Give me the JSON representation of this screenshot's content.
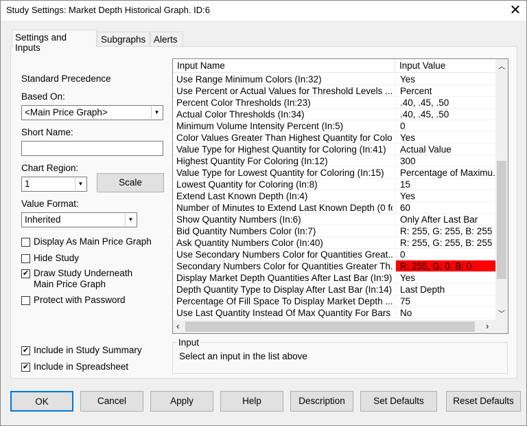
{
  "window": {
    "title": "Study Settings: Market Depth Historical Graph. ID:6",
    "close": "✕"
  },
  "tabs": [
    {
      "label": "Settings and Inputs"
    },
    {
      "label": "Subgraphs"
    },
    {
      "label": "Alerts"
    }
  ],
  "left": {
    "precedence": "Standard Precedence",
    "based_on_label": "Based On:",
    "based_on_value": "<Main Price Graph>",
    "short_name_label": "Short Name:",
    "short_name_value": "",
    "chart_region_label": "Chart Region:",
    "chart_region_value": "1",
    "scale_button": "Scale",
    "value_format_label": "Value Format:",
    "value_format_value": "Inherited",
    "checkboxes": [
      {
        "label": "Display As Main Price Graph",
        "checked": false
      },
      {
        "label": "Hide Study",
        "checked": false
      },
      {
        "label": "Draw Study Underneath Main Price Graph",
        "checked": true
      },
      {
        "label": "Protect with Password",
        "checked": false
      },
      {
        "label": "Include in Study Summary",
        "checked": true
      },
      {
        "label": "Include in Spreadsheet",
        "checked": true
      }
    ]
  },
  "inputs": {
    "headers": {
      "name": "Input Name",
      "value": "Input Value"
    },
    "rows": [
      {
        "name": "Use Range Minimum Colors   (In:32)",
        "value": "Yes"
      },
      {
        "name": "Use Percent or Actual Values for Threshold Levels   ...",
        "value": "Percent"
      },
      {
        "name": "Percent Color Thresholds   (In:23)",
        "value": ".40, .45, .50"
      },
      {
        "name": "Actual Color Thresholds   (In:34)",
        "value": ".40, .45, .50"
      },
      {
        "name": "Minimum Volume Intensity Percent   (In:5)",
        "value": "0"
      },
      {
        "name": "Color Values Greater Than Highest Quantity for Colo...",
        "value": "Yes"
      },
      {
        "name": "Value Type for Highest Quantity for Coloring   (In:41)",
        "value": "Actual Value"
      },
      {
        "name": "Highest Quantity For Coloring   (In:12)",
        "value": "300"
      },
      {
        "name": "Value Type for Lowest Quantity for Coloring   (In:15)",
        "value": "Percentage of Maximu..."
      },
      {
        "name": "Lowest Quantity for Coloring   (In:8)",
        "value": "15"
      },
      {
        "name": "Extend Last Known Depth   (In:4)",
        "value": "Yes"
      },
      {
        "name": "Number of Minutes to Extend Last Known Depth (0 fo...",
        "value": "60"
      },
      {
        "name": "Show Quantity Numbers   (In:6)",
        "value": "Only After Last Bar"
      },
      {
        "name": "Bid Quantity Numbers Color   (In:7)",
        "value": "R: 255, G: 255, B: 255"
      },
      {
        "name": "Ask Quantity Numbers Color   (In:40)",
        "value": "R: 255, G: 255, B: 255"
      },
      {
        "name": "Use Secondary Numbers Color for Quantities Great...",
        "value": "0"
      },
      {
        "name": "Secondary Numbers Color for Quantities Greater Th...",
        "value": "R: 255, G: 0, B: 0",
        "swatch": "#ff0000"
      },
      {
        "name": "Display Market Depth Quantities After Last Bar   (In:9)",
        "value": "Yes"
      },
      {
        "name": "Depth Quantity Type to Display After Last Bar   (In:14)",
        "value": "Last Depth"
      },
      {
        "name": "Percentage Of Fill Space To Display Market Depth ...",
        "value": "75"
      },
      {
        "name": "Use Last Quantity Instead Of Max Quantity For Bars   ...",
        "value": "No"
      }
    ]
  },
  "input_group": {
    "title": "Input",
    "text": "Select an input in the list above"
  },
  "buttons": [
    "OK",
    "Cancel",
    "Apply",
    "Help",
    "Description",
    "Set Defaults",
    "Reset Defaults"
  ]
}
